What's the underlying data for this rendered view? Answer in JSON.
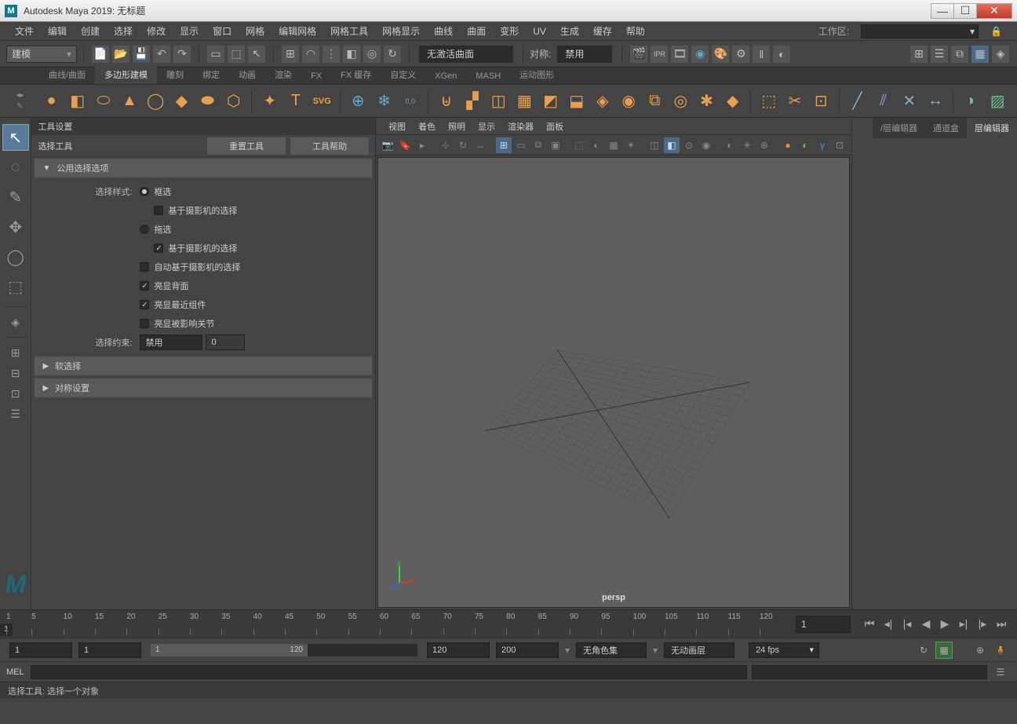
{
  "title": "Autodesk Maya 2019: 无标题",
  "menubar": [
    "文件",
    "编辑",
    "创建",
    "选择",
    "修改",
    "显示",
    "窗口",
    "网格",
    "编辑网格",
    "网格工具",
    "网格显示",
    "曲线",
    "曲面",
    "变形",
    "UV",
    "生成",
    "缓存",
    "帮助"
  ],
  "workspace_label": "工作区:",
  "toolbar": {
    "mode": "建模",
    "status1": "无激活曲面",
    "sym_label": "对称:",
    "sym_value": "禁用"
  },
  "shelf_tabs": [
    "曲线/曲面",
    "多边形建模",
    "雕刻",
    "绑定",
    "动画",
    "渲染",
    "FX",
    "FX 缓存",
    "自定义",
    "XGen",
    "MASH",
    "运动图形"
  ],
  "shelf_active": 1,
  "tool_settings": {
    "title": "工具设置",
    "tool_name": "选择工具",
    "reset": "重置工具",
    "help": "工具帮助",
    "sections": {
      "common": "公用选择选项",
      "soft": "软选择",
      "sym": "对称设置"
    },
    "labels": {
      "select_style": "选择样式:",
      "marquee": "框选",
      "camera_based1": "基于摄影机的选择",
      "drag": "拖选",
      "camera_based2": "基于摄影机的选择",
      "auto_camera": "自动基于摄影机的选择",
      "highlight_back": "亮显背面",
      "highlight_near": "亮显最近组件",
      "highlight_joint": "亮显被影响关节",
      "constraint": "选择约束:",
      "constraint_val": "禁用",
      "constraint_num": "0"
    }
  },
  "viewport": {
    "menu": [
      "视图",
      "着色",
      "照明",
      "显示",
      "渲染器",
      "面板"
    ],
    "label": "persp"
  },
  "right_tabs": [
    "/层编辑器",
    "通道盒",
    "层编辑器"
  ],
  "timeline": {
    "ticks": [
      1,
      5,
      10,
      15,
      20,
      25,
      30,
      35,
      40,
      45,
      50,
      55,
      60,
      65,
      70,
      75,
      80,
      85,
      90,
      95,
      100,
      105,
      110,
      115,
      120
    ],
    "current": "1",
    "field": "1"
  },
  "range": {
    "start": "1",
    "in": "1",
    "out": "120",
    "end": "200",
    "thumb_in": "1",
    "thumb_out": "120",
    "charset": "无角色集",
    "animlayer": "无动画层",
    "fps": "24 fps"
  },
  "mel": {
    "label": "MEL"
  },
  "status": "选择工具: 选择一个对象"
}
